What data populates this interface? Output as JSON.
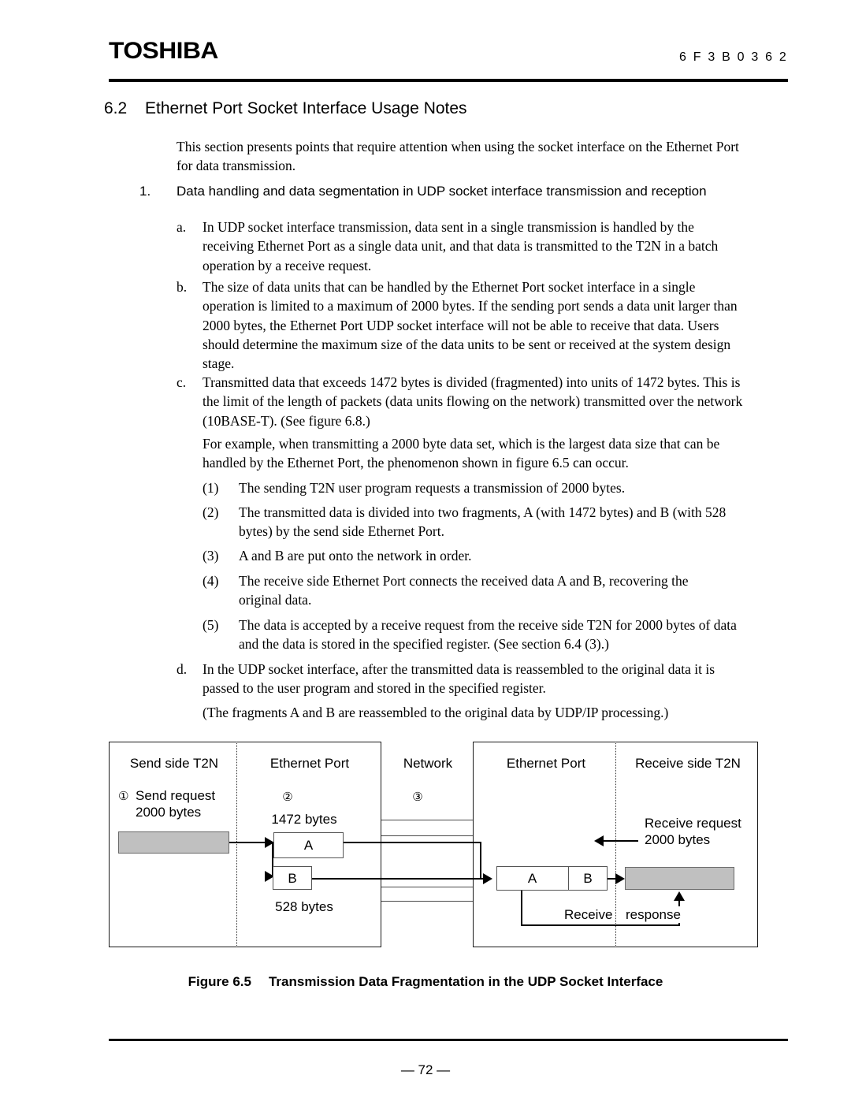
{
  "header": {
    "logo": "TOSHIBA",
    "doc_code": "6 F 3 B 0 3 6 2"
  },
  "section": {
    "number": "6.2",
    "title": "Ethernet Port Socket Interface Usage Notes"
  },
  "intro": "This section presents points that require attention when using the socket interface on the Ethernet Port for data transmission.",
  "item1": {
    "marker": "1.",
    "text": "Data handling and data segmentation in UDP socket interface transmission and reception"
  },
  "sub_a": {
    "marker": "a.",
    "text": "In UDP socket interface transmission, data sent in a single transmission is handled by the receiving Ethernet Port as a single data unit, and that data is transmitted to the T2N in a batch operation by a receive request."
  },
  "sub_b": {
    "marker": "b.",
    "text": "The size of data units that can be handled by the Ethernet Port socket interface in a single operation is limited to a maximum of 2000 bytes. If the sending port sends a data unit larger than 2000 bytes, the Ethernet Port UDP socket interface will not be able to receive that data. Users should determine the maximum size of the data units to be sent or received at the system design stage."
  },
  "sub_c": {
    "marker": "c.",
    "text": "Transmitted data that exceeds 1472 bytes is divided (fragmented) into units of 1472 bytes. This is the limit of the length of packets (data units flowing on the network) transmitted over the network (10BASE-T). (See figure 6.8.)"
  },
  "example_intro": "For example, when transmitting a 2000 byte data set, which is the largest data size that can be handled by the Ethernet Port, the phenomenon shown in figure 6.5 can occur.",
  "steps": [
    {
      "marker": "(1)",
      "text": "The sending T2N user program requests a transmission of 2000 bytes."
    },
    {
      "marker": "(2)",
      "text": "The transmitted data is divided into two fragments, A (with 1472 bytes) and B (with 528 bytes) by the send side Ethernet Port."
    },
    {
      "marker": "(3)",
      "text": "A and B are put onto the network in order."
    },
    {
      "marker": "(4)",
      "text": "The receive side Ethernet Port connects the received data A and B, recovering the original data."
    },
    {
      "marker": "(5)",
      "text": "The data is accepted by a receive request from the receive side T2N for 2000 bytes of data and the data is stored in the specified register. (See section 6.4 (3).)"
    }
  ],
  "sub_d": {
    "marker": "d.",
    "text": "In the UDP socket interface, after the transmitted data is reassembled to the original data it is passed to the user program and stored in the specified register."
  },
  "note": "(The fragments A and B are reassembled to the original data by UDP/IP processing.)",
  "figure": {
    "columns": {
      "send_t2n": "Send side T2N",
      "send_port": "Ethernet Port",
      "network": "Network",
      "recv_port": "Ethernet Port",
      "recv_t2n": "Receive side T2N"
    },
    "callouts": {
      "one": "①",
      "two": "②",
      "three": "③"
    },
    "send_request_line1": "Send request",
    "send_request_line2": "2000 bytes",
    "size_a": "1472 bytes",
    "size_b": "528 bytes",
    "frag_a": "A",
    "frag_b": "B",
    "recv_frag_a": "A",
    "recv_frag_b": "B",
    "receive_request_line1": "Receive request",
    "receive_request_line2": "2000 bytes",
    "receive_response_left": "Receive",
    "receive_response_right": "response"
  },
  "caption": {
    "label": "Figure 6.5",
    "title": "Transmission Data Fragmentation in the UDP Socket Interface"
  },
  "footer": {
    "page_number": "— 72 —"
  }
}
